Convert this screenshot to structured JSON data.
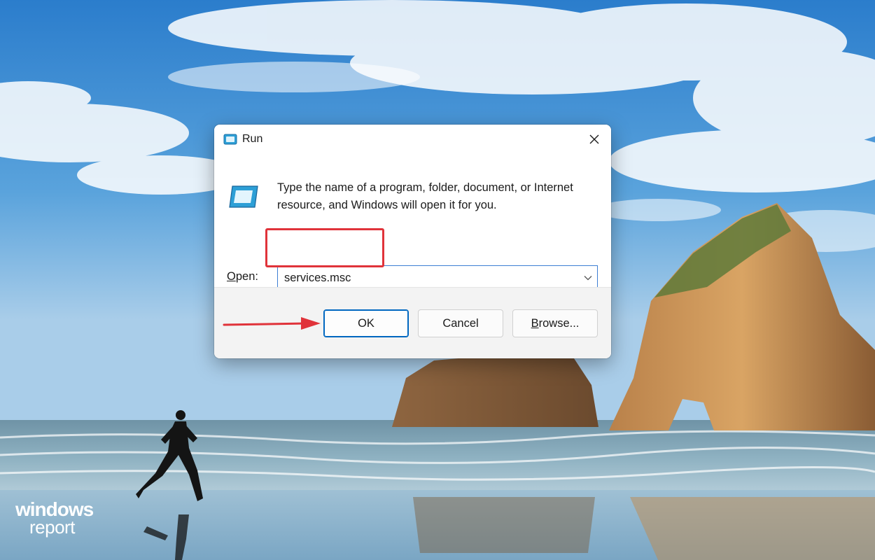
{
  "watermark": {
    "line1": "windows",
    "line2": "report"
  },
  "dialog": {
    "title": "Run",
    "title_icon": "run-icon",
    "close_icon": "close-icon",
    "description": "Type the name of a program, folder, document, or Internet resource, and Windows will open it for you.",
    "open_label_accel": "O",
    "open_label_rest": "pen:",
    "input_value": "services.msc",
    "dropdown_icon": "chevron-down-icon",
    "buttons": {
      "ok": "OK",
      "cancel": "Cancel",
      "browse_accel": "B",
      "browse_rest": "rowse..."
    }
  },
  "colors": {
    "accent": "#0067c0",
    "annotation": "#e0333a",
    "input_border": "#3d7fd4",
    "footer_bg": "#f3f3f3"
  }
}
